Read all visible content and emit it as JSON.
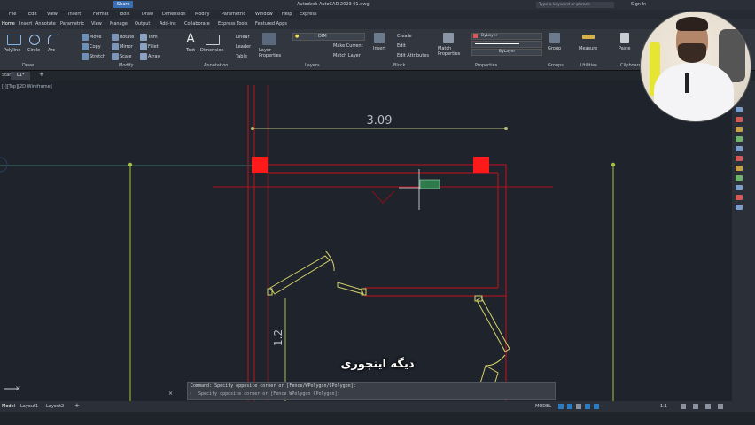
{
  "titlebar": {
    "app_title": "Autodesk AutoCAD 2023   01.dwg",
    "share_label": "Share",
    "search_placeholder": "Type a keyword or phrase",
    "signin_label": "Sign In"
  },
  "menubar": {
    "items": [
      "File",
      "Edit",
      "View",
      "Insert",
      "Format",
      "Tools",
      "Draw",
      "Dimension",
      "Modify",
      "Parametric",
      "Window",
      "Help",
      "Express"
    ]
  },
  "ribbon_tabs": {
    "items": [
      "Home",
      "Insert",
      "Annotate",
      "Parametric",
      "View",
      "Manage",
      "Output",
      "Add-ins",
      "Collaborate",
      "Express Tools",
      "Featured Apps"
    ]
  },
  "ribbon": {
    "draw": {
      "polyline": "Polyline",
      "circle": "Circle",
      "arc": "Arc",
      "group_label": "Draw"
    },
    "modify": {
      "move": "Move",
      "rotate": "Rotate",
      "trim": "Trim",
      "copy": "Copy",
      "mirror": "Mirror",
      "fillet": "Fillet",
      "stretch": "Stretch",
      "scale": "Scale",
      "array": "Array",
      "group_label": "Modify"
    },
    "annotation": {
      "text": "Text",
      "dimension": "Dimension",
      "linear": "Linear",
      "leader": "Leader",
      "table": "Table",
      "group_label": "Annotation"
    },
    "layers": {
      "layer_properties": "Layer Properties",
      "make_current": "Make Current",
      "match_layer": "Match Layer",
      "current_layer": "DIM",
      "group_label": "Layers"
    },
    "block": {
      "insert": "Insert",
      "create": "Create",
      "edit": "Edit",
      "edit_attributes": "Edit Attributes",
      "group_label": "Block"
    },
    "properties": {
      "match_properties": "Match Properties",
      "color": "ByLayer",
      "lineweight": "ByLayer",
      "linetype": "ByLayer",
      "group_label": "Properties"
    },
    "groups": {
      "group": "Group",
      "group_label": "Groups"
    },
    "utilities": {
      "measure": "Measure",
      "group_label": "Utilities"
    },
    "clipboard": {
      "paste": "Paste",
      "group_label": "Clipboard"
    }
  },
  "file_tabs": {
    "start": "Start",
    "active": "01*"
  },
  "viewport_label": "[-][Top][2D Wireframe]",
  "drawing": {
    "dim_top": "3.09",
    "dim_side": "1.2"
  },
  "command": {
    "history": "Command: Specify opposite corner or [Fence/WPolygon/CPolygon]:",
    "prompt": "Specify opposite corner or [Fence WPolygon CPolygon]:"
  },
  "status": {
    "model_tab": "Model",
    "layout1": "Layout1",
    "layout2": "Layout2",
    "mode": "MODEL",
    "scale": "1:1"
  },
  "subtitle": "دیگه اینجوری",
  "colors": {
    "accent": "#3b6fb5",
    "wall_red": "#d01020",
    "grip_red": "#ff1a1a",
    "dim_green": "#b8c26a",
    "construction": "#a9c13b"
  }
}
